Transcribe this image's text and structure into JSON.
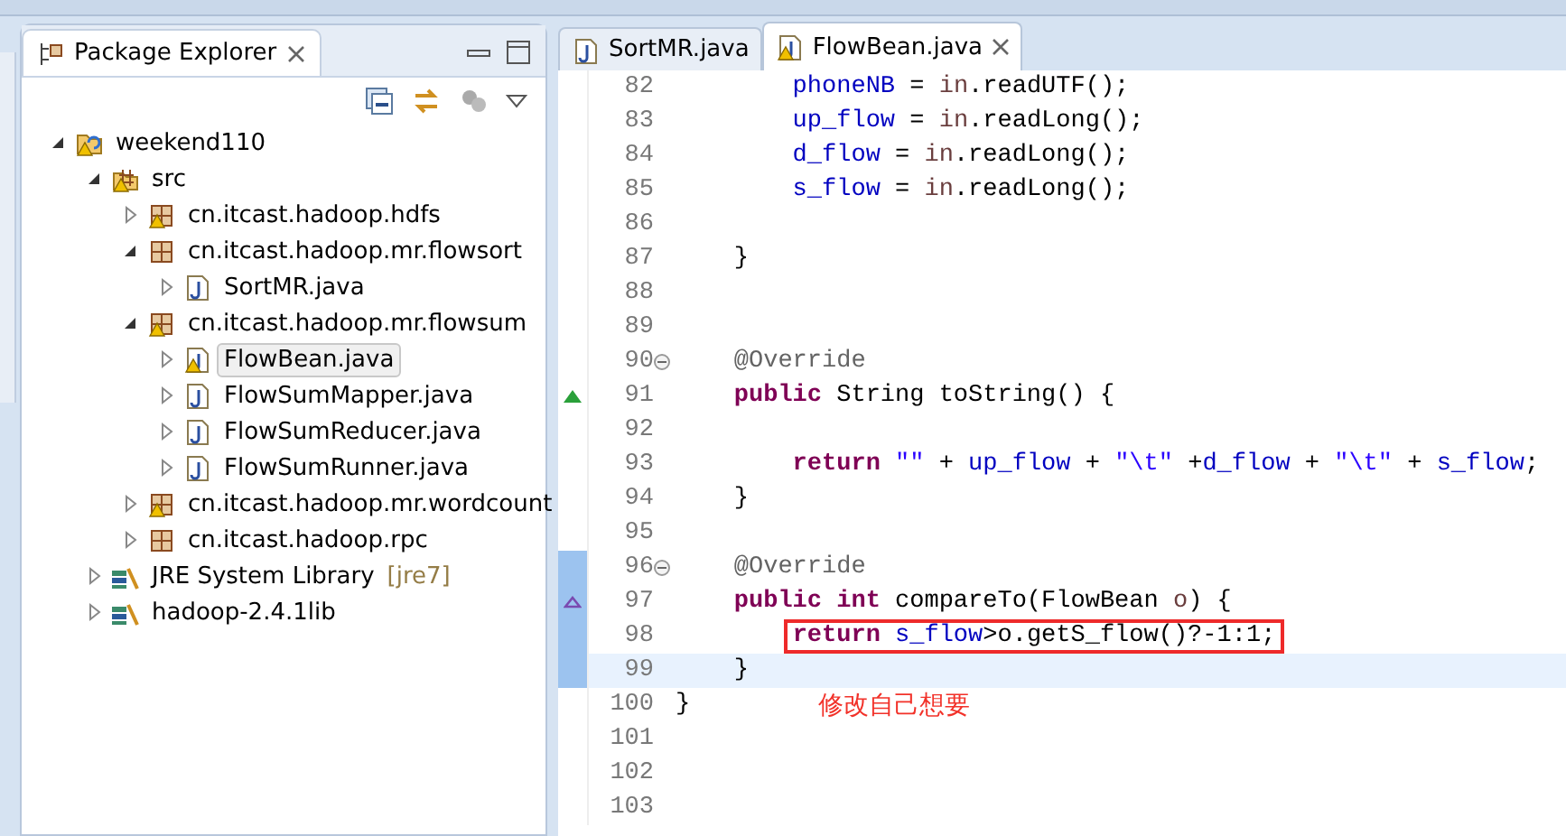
{
  "package_explorer": {
    "title": "Package Explorer",
    "tree": [
      {
        "label": "weekend110",
        "kind": "project",
        "warning": true,
        "expanded": true,
        "selected": false,
        "children": [
          {
            "label": "src",
            "kind": "source",
            "warning": true,
            "expanded": true,
            "selected": false,
            "children": [
              {
                "label": "cn.itcast.hadoop.hdfs",
                "kind": "package",
                "warning": true,
                "expanded": false,
                "selected": false
              },
              {
                "label": "cn.itcast.hadoop.mr.flowsort",
                "kind": "package",
                "warning": false,
                "expanded": true,
                "selected": false,
                "children": [
                  {
                    "label": "SortMR.java",
                    "kind": "java",
                    "warning": false,
                    "expanded": false,
                    "selected": false
                  }
                ]
              },
              {
                "label": "cn.itcast.hadoop.mr.flowsum",
                "kind": "package",
                "warning": true,
                "expanded": true,
                "selected": false,
                "children": [
                  {
                    "label": "FlowBean.java",
                    "kind": "java",
                    "warning": true,
                    "expanded": false,
                    "selected": true
                  },
                  {
                    "label": "FlowSumMapper.java",
                    "kind": "java",
                    "warning": false,
                    "expanded": false,
                    "selected": false
                  },
                  {
                    "label": "FlowSumReducer.java",
                    "kind": "java",
                    "warning": false,
                    "expanded": false,
                    "selected": false
                  },
                  {
                    "label": "FlowSumRunner.java",
                    "kind": "java",
                    "warning": false,
                    "expanded": false,
                    "selected": false
                  }
                ]
              },
              {
                "label": "cn.itcast.hadoop.mr.wordcount",
                "kind": "package",
                "warning": true,
                "expanded": false,
                "selected": false
              },
              {
                "label": "cn.itcast.hadoop.rpc",
                "kind": "package",
                "warning": false,
                "expanded": false,
                "selected": false
              }
            ]
          },
          {
            "label": "JRE System Library",
            "decoration": "[jre7]",
            "kind": "library",
            "warning": false,
            "expanded": false,
            "selected": false
          },
          {
            "label": "hadoop-2.4.1lib",
            "kind": "library",
            "warning": false,
            "expanded": false,
            "selected": false
          }
        ]
      }
    ]
  },
  "editor": {
    "tabs": [
      {
        "label": "SortMR.java",
        "selected": false,
        "warning": false
      },
      {
        "label": "FlowBean.java",
        "selected": true,
        "warning": true
      }
    ],
    "lines": [
      {
        "number": "82",
        "fold": false,
        "changed": false,
        "current": false,
        "boxed": false,
        "tokens": [
          {
            "kind": "field",
            "text": "        phoneNB"
          },
          {
            "kind": "plain",
            "text": " = "
          },
          {
            "kind": "var",
            "text": "in"
          },
          {
            "kind": "plain",
            "text": ".readUTF();"
          }
        ]
      },
      {
        "number": "83",
        "fold": false,
        "changed": false,
        "current": false,
        "boxed": false,
        "tokens": [
          {
            "kind": "field",
            "text": "        up_flow"
          },
          {
            "kind": "plain",
            "text": " = "
          },
          {
            "kind": "var",
            "text": "in"
          },
          {
            "kind": "plain",
            "text": ".readLong();"
          }
        ]
      },
      {
        "number": "84",
        "fold": false,
        "changed": false,
        "current": false,
        "boxed": false,
        "tokens": [
          {
            "kind": "field",
            "text": "        d_flow"
          },
          {
            "kind": "plain",
            "text": " = "
          },
          {
            "kind": "var",
            "text": "in"
          },
          {
            "kind": "plain",
            "text": ".readLong();"
          }
        ]
      },
      {
        "number": "85",
        "fold": false,
        "changed": false,
        "current": false,
        "boxed": false,
        "tokens": [
          {
            "kind": "field",
            "text": "        s_flow"
          },
          {
            "kind": "plain",
            "text": " = "
          },
          {
            "kind": "var",
            "text": "in"
          },
          {
            "kind": "plain",
            "text": ".readLong();"
          }
        ]
      },
      {
        "number": "86",
        "fold": false,
        "changed": false,
        "current": false,
        "boxed": false
      },
      {
        "number": "87",
        "fold": false,
        "changed": false,
        "current": false,
        "boxed": false,
        "tokens": [
          {
            "kind": "plain",
            "text": "    }"
          }
        ]
      },
      {
        "number": "88",
        "fold": false,
        "changed": false,
        "current": false,
        "boxed": false
      },
      {
        "number": "89",
        "fold": false,
        "changed": false,
        "current": false,
        "boxed": false
      },
      {
        "number": "90",
        "fold": true,
        "changed": false,
        "current": false,
        "boxed": false,
        "tokens": [
          {
            "kind": "ann",
            "text": "    @Override"
          }
        ]
      },
      {
        "number": "91",
        "kind": "override",
        "fold": false,
        "changed": false,
        "current": false,
        "boxed": false,
        "tokens": [
          {
            "kind": "kw",
            "text": "    public"
          },
          {
            "kind": "plain",
            "text": " String toString() {"
          }
        ]
      },
      {
        "number": "92",
        "fold": false,
        "changed": false,
        "current": false,
        "boxed": false
      },
      {
        "number": "93",
        "fold": false,
        "changed": false,
        "current": false,
        "boxed": false,
        "tokens": [
          {
            "kind": "kw",
            "text": "        return"
          },
          {
            "kind": "str",
            "text": " \"\""
          },
          {
            "kind": "plain",
            "text": " + "
          },
          {
            "kind": "field",
            "text": "up_flow"
          },
          {
            "kind": "plain",
            "text": " + "
          },
          {
            "kind": "str",
            "text": "\"\\t\""
          },
          {
            "kind": "plain",
            "text": " +"
          },
          {
            "kind": "field",
            "text": "d_flow"
          },
          {
            "kind": "plain",
            "text": " + "
          },
          {
            "kind": "str",
            "text": "\"\\t\""
          },
          {
            "kind": "plain",
            "text": " + "
          },
          {
            "kind": "field",
            "text": "s_flow"
          },
          {
            "kind": "plain",
            "text": ";"
          }
        ]
      },
      {
        "number": "94",
        "fold": false,
        "changed": false,
        "current": false,
        "boxed": false,
        "tokens": [
          {
            "kind": "plain",
            "text": "    }"
          }
        ]
      },
      {
        "number": "95",
        "fold": false,
        "changed": false,
        "current": false,
        "boxed": false
      },
      {
        "number": "96",
        "fold": true,
        "changed": true,
        "current": false,
        "boxed": false,
        "tokens": [
          {
            "kind": "ann",
            "text": "    @Override"
          }
        ]
      },
      {
        "number": "97",
        "kind": "implements",
        "fold": false,
        "changed": true,
        "current": false,
        "boxed": false,
        "tokens": [
          {
            "kind": "kw",
            "text": "    public"
          },
          {
            "kind": "kw",
            "text": " int"
          },
          {
            "kind": "plain",
            "text": " compareTo(FlowBean "
          },
          {
            "kind": "var",
            "text": "o"
          },
          {
            "kind": "plain",
            "text": ") {"
          }
        ]
      },
      {
        "number": "98",
        "fold": false,
        "changed": true,
        "current": false,
        "boxed": true,
        "tokens": [
          {
            "kind": "kw",
            "text": "return"
          },
          {
            "kind": "field",
            "text": " s_flow"
          },
          {
            "kind": "plain",
            "text": ">o.getS_flow()?-1:1;"
          }
        ]
      },
      {
        "number": "99",
        "fold": false,
        "changed": true,
        "current": true,
        "boxed": false,
        "tokens": [
          {
            "kind": "plain",
            "text": "    }"
          }
        ]
      },
      {
        "number": "100",
        "fold": false,
        "changed": false,
        "current": false,
        "boxed": false,
        "tokens": [
          {
            "kind": "plain",
            "text": "}"
          }
        ],
        "note": "修改自己想要"
      },
      {
        "number": "101",
        "fold": false,
        "changed": false,
        "current": false,
        "boxed": false
      },
      {
        "number": "102",
        "fold": false,
        "changed": false,
        "current": false,
        "boxed": false
      },
      {
        "number": "103",
        "fold": false,
        "changed": false,
        "current": false,
        "boxed": false
      }
    ]
  }
}
